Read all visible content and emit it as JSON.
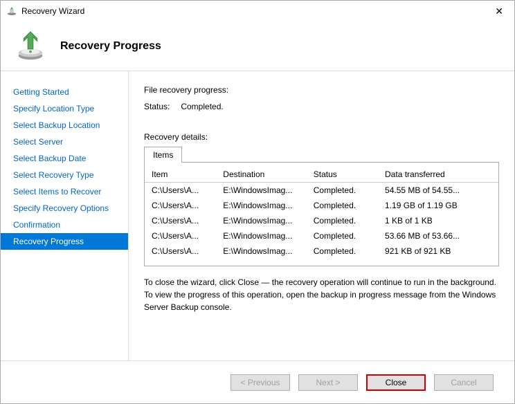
{
  "window": {
    "title": "Recovery Wizard"
  },
  "header": {
    "title": "Recovery Progress"
  },
  "sidebar": {
    "items": [
      {
        "label": "Getting Started"
      },
      {
        "label": "Specify Location Type"
      },
      {
        "label": "Select Backup Location"
      },
      {
        "label": "Select Server"
      },
      {
        "label": "Select Backup Date"
      },
      {
        "label": "Select Recovery Type"
      },
      {
        "label": "Select Items to Recover"
      },
      {
        "label": "Specify Recovery Options"
      },
      {
        "label": "Confirmation"
      },
      {
        "label": "Recovery Progress"
      }
    ],
    "activeIndex": 9
  },
  "main": {
    "progress_label": "File recovery progress:",
    "status_label": "Status:",
    "status_value": "Completed.",
    "details_label": "Recovery details:",
    "tab_label": "Items",
    "columns": {
      "item": "Item",
      "destination": "Destination",
      "status": "Status",
      "data": "Data transferred"
    },
    "rows": [
      {
        "item": "C:\\Users\\A...",
        "dest": "E:\\WindowsImag...",
        "status": "Completed.",
        "data": "54.55 MB of 54.55..."
      },
      {
        "item": "C:\\Users\\A...",
        "dest": "E:\\WindowsImag...",
        "status": "Completed.",
        "data": "1.19 GB of 1.19 GB"
      },
      {
        "item": "C:\\Users\\A...",
        "dest": "E:\\WindowsImag...",
        "status": "Completed.",
        "data": "1 KB of 1 KB"
      },
      {
        "item": "C:\\Users\\A...",
        "dest": "E:\\WindowsImag...",
        "status": "Completed.",
        "data": "53.66 MB of 53.66..."
      },
      {
        "item": "C:\\Users\\A...",
        "dest": "E:\\WindowsImag...",
        "status": "Completed.",
        "data": "921 KB of 921 KB"
      }
    ],
    "help_text": "To close the wizard, click Close — the recovery operation will continue to run in the background. To view the progress of this operation, open the backup in progress message from the Windows Server Backup console."
  },
  "footer": {
    "previous": "< Previous",
    "next": "Next >",
    "close": "Close",
    "cancel": "Cancel"
  }
}
